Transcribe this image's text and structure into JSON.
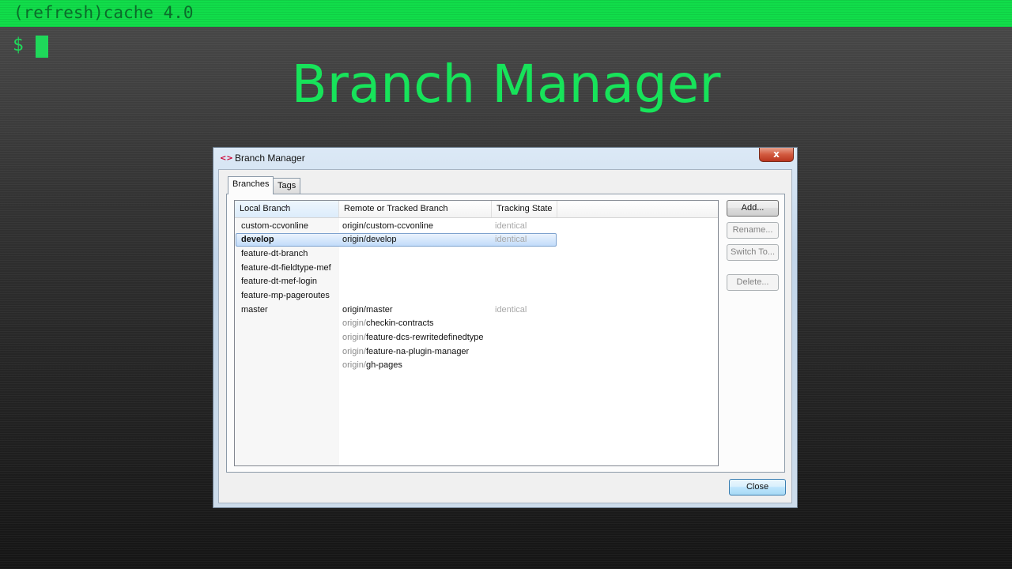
{
  "terminal": {
    "title": "(refresh)cache 4.0",
    "prompt": "$"
  },
  "slide": {
    "title": "Branch Manager"
  },
  "dialog": {
    "title": "Branch Manager",
    "icon": "code-brackets-icon",
    "close_glyph": "x",
    "tabs": [
      {
        "label": "Branches",
        "active": true
      },
      {
        "label": "Tags",
        "active": false
      }
    ],
    "columns": [
      "Local Branch",
      "Remote or Tracked Branch",
      "Tracking State"
    ],
    "rows": [
      {
        "local": "custom-ccvonline",
        "remote_prefix": "origin/custom-ccvonline",
        "remote_suffix": "",
        "state": "identical",
        "selected": false
      },
      {
        "local": "develop",
        "remote_prefix": "origin/develop",
        "remote_suffix": "",
        "state": "identical",
        "selected": true
      },
      {
        "local": "feature-dt-branch",
        "remote_prefix": "",
        "remote_suffix": "",
        "state": "",
        "selected": false
      },
      {
        "local": "feature-dt-fieldtype-mef",
        "remote_prefix": "",
        "remote_suffix": "",
        "state": "",
        "selected": false
      },
      {
        "local": "feature-dt-mef-login",
        "remote_prefix": "",
        "remote_suffix": "",
        "state": "",
        "selected": false
      },
      {
        "local": "feature-mp-pageroutes",
        "remote_prefix": "",
        "remote_suffix": "",
        "state": "",
        "selected": false
      },
      {
        "local": "master",
        "remote_prefix": "origin/master",
        "remote_suffix": "",
        "state": "identical",
        "selected": false
      },
      {
        "local": "",
        "remote_prefix": "origin/",
        "remote_suffix": "checkin-contracts",
        "state": "",
        "selected": false
      },
      {
        "local": "",
        "remote_prefix": "origin/",
        "remote_suffix": "feature-dcs-rewritedefinedtype",
        "state": "",
        "selected": false
      },
      {
        "local": "",
        "remote_prefix": "origin/",
        "remote_suffix": "feature-na-plugin-manager",
        "state": "",
        "selected": false
      },
      {
        "local": "",
        "remote_prefix": "origin/",
        "remote_suffix": "gh-pages",
        "state": "",
        "selected": false
      }
    ],
    "buttons": {
      "add": "Add...",
      "rename": "Rename...",
      "switch": "Switch To...",
      "delete": "Delete...",
      "close": "Close"
    }
  }
}
